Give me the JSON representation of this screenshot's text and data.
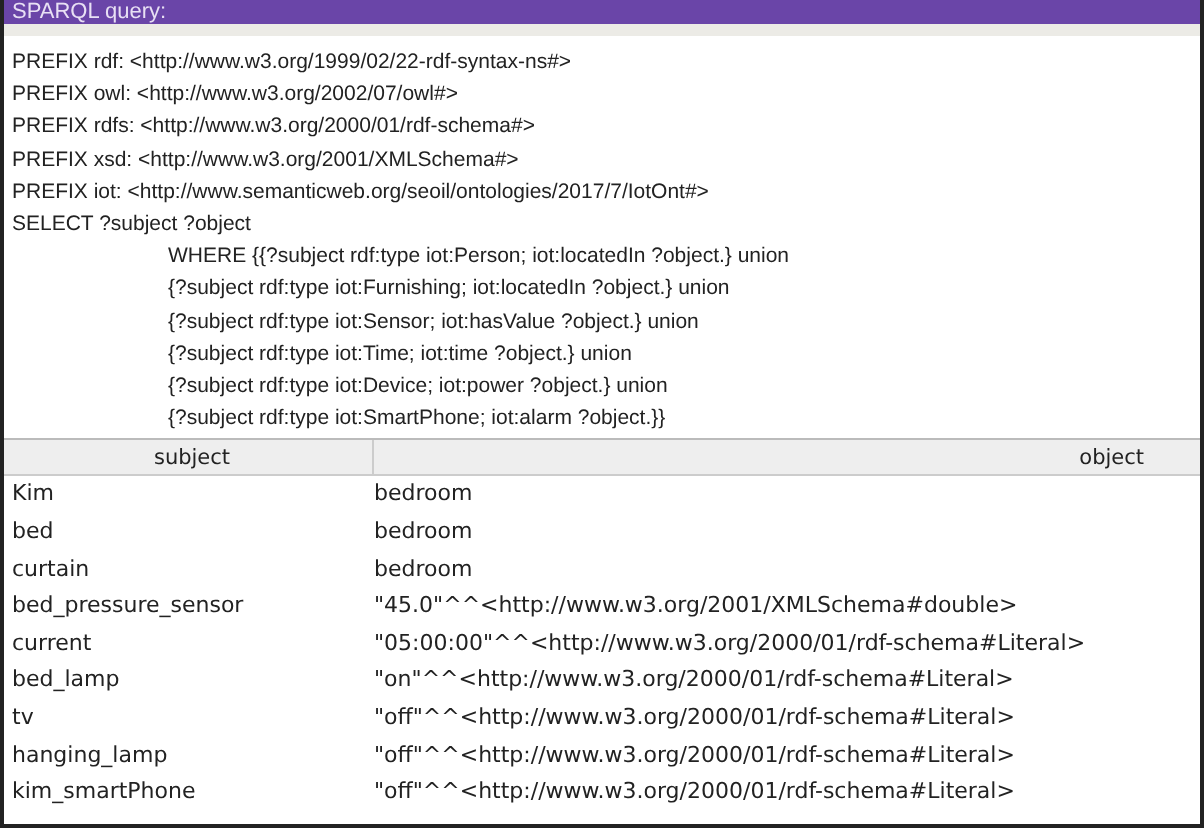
{
  "panel": {
    "title": "SPARQL query:"
  },
  "query": [
    {
      "kind": "line",
      "text": "PREFIX rdf: <http://www.w3.org/1999/02/22-rdf-syntax-ns#>"
    },
    {
      "kind": "line",
      "text": "PREFIX owl: <http://www.w3.org/2002/07/owl#>"
    },
    {
      "kind": "line",
      "text": "PREFIX rdfs: <http://www.w3.org/2000/01/rdf-schema#>"
    },
    {
      "kind": "line",
      "text": "PREFIX xsd: <http://www.w3.org/2001/XMLSchema#>"
    },
    {
      "kind": "line",
      "text": "PREFIX iot: <http://www.semanticweb.org/seoil/ontologies/2017/7/IotOnt#>"
    },
    {
      "kind": "line",
      "text": "SELECT ?subject ?object"
    },
    {
      "kind": "indented",
      "text": "WHERE {{?subject rdf:type iot:Person; iot:locatedIn ?object.} union"
    },
    {
      "kind": "indented",
      "text": "{?subject rdf:type iot:Furnishing; iot:locatedIn ?object.} union"
    },
    {
      "kind": "indented",
      "text": "{?subject rdf:type iot:Sensor; iot:hasValue ?object.} union"
    },
    {
      "kind": "indented",
      "text": "{?subject rdf:type iot:Time; iot:time ?object.} union"
    },
    {
      "kind": "indented",
      "text": "{?subject rdf:type iot:Device; iot:power ?object.} union"
    },
    {
      "kind": "indented",
      "text": "{?subject rdf:type iot:SmartPhone; iot:alarm ?object.}}"
    }
  ],
  "table": {
    "columns": [
      "subject",
      "object"
    ],
    "rows": [
      [
        "Kim",
        "bedroom"
      ],
      [
        "bed",
        "bedroom"
      ],
      [
        "curtain",
        "bedroom"
      ],
      [
        "bed_pressure_sensor",
        "\"45.0\"^^<http://www.w3.org/2001/XMLSchema#double>"
      ],
      [
        "current",
        "\"05:00:00\"^^<http://www.w3.org/2000/01/rdf-schema#Literal>"
      ],
      [
        "bed_lamp",
        "\"on\"^^<http://www.w3.org/2000/01/rdf-schema#Literal>"
      ],
      [
        "tv",
        "\"off\"^^<http://www.w3.org/2000/01/rdf-schema#Literal>"
      ],
      [
        "hanging_lamp",
        "\"off\"^^<http://www.w3.org/2000/01/rdf-schema#Literal>"
      ],
      [
        "kim_smartPhone",
        "\"off\"^^<http://www.w3.org/2000/01/rdf-schema#Literal>"
      ]
    ]
  }
}
